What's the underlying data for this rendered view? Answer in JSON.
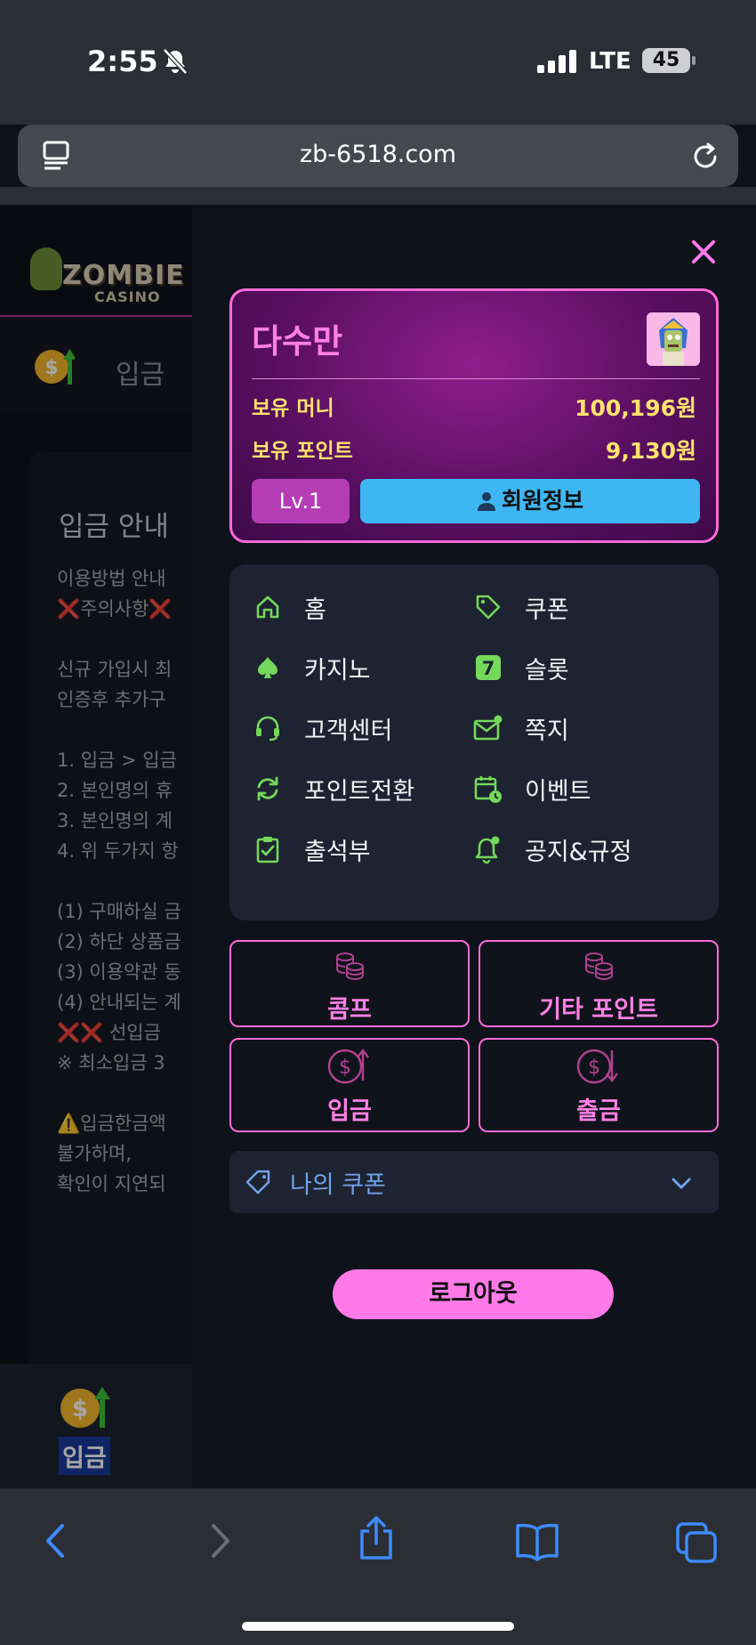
{
  "status_bar": {
    "time": "2:55",
    "network": "LTE",
    "battery": "45"
  },
  "browser": {
    "url": "zb-6518.com"
  },
  "background_page": {
    "logo": {
      "word1": "ZOMBIE",
      "word2": "CASINO"
    },
    "tab_label": "입금",
    "notice_title": "입금 안내",
    "notice_lines": [
      "이용방법 안내",
      "❌주의사항❌",
      "",
      "신규 가입시 최",
      "인증후 추가구",
      "",
      "1. 입금 > 입금",
      "2. 본인명의 휴",
      "3. 본인명의 계",
      "4. 위 두가지 항",
      "",
      "(1) 구매하실 금",
      "(2) 하단 상품금",
      "(3) 이용약관 동",
      "(4) 안내되는 계",
      "❌❌ 선입금",
      "※ 최소입금 3",
      "",
      "⚠️입금한금액",
      "불가하며,",
      "확인이 지연되"
    ],
    "bottom_tab_label": "입금"
  },
  "panel": {
    "user_card": {
      "name": "다수만",
      "money_label": "보유 머니",
      "money_value": "100,196원",
      "points_label": "보유 포인트",
      "points_value": "9,130원",
      "level": "Lv.1",
      "member_info_button": "회원정보"
    },
    "menu": [
      {
        "label": "홈",
        "icon": "home-icon"
      },
      {
        "label": "쿠폰",
        "icon": "tag-icon"
      },
      {
        "label": "카지노",
        "icon": "spade-icon"
      },
      {
        "label": "슬롯",
        "icon": "seven-icon"
      },
      {
        "label": "고객센터",
        "icon": "headset-icon"
      },
      {
        "label": "쪽지",
        "icon": "mail-icon"
      },
      {
        "label": "포인트전환",
        "icon": "refresh-icon"
      },
      {
        "label": "이벤트",
        "icon": "calendar-icon"
      },
      {
        "label": "출석부",
        "icon": "clipboard-check-icon"
      },
      {
        "label": "공지&규정",
        "icon": "bell-icon"
      }
    ],
    "point_buttons": [
      {
        "label": "콤프",
        "icon": "coins-icon"
      },
      {
        "label": "기타 포인트",
        "icon": "coins-icon"
      },
      {
        "label": "입금",
        "icon": "dollar-up-icon"
      },
      {
        "label": "출금",
        "icon": "dollar-down-icon"
      }
    ],
    "coupon_dropdown": "나의 쿠폰",
    "logout_button": "로그아웃"
  },
  "colors": {
    "accent_pink": "#ff6bd9",
    "icon_green": "#74d85a",
    "gold_text": "#ffe36d",
    "info_blue": "#3eb6f2"
  }
}
